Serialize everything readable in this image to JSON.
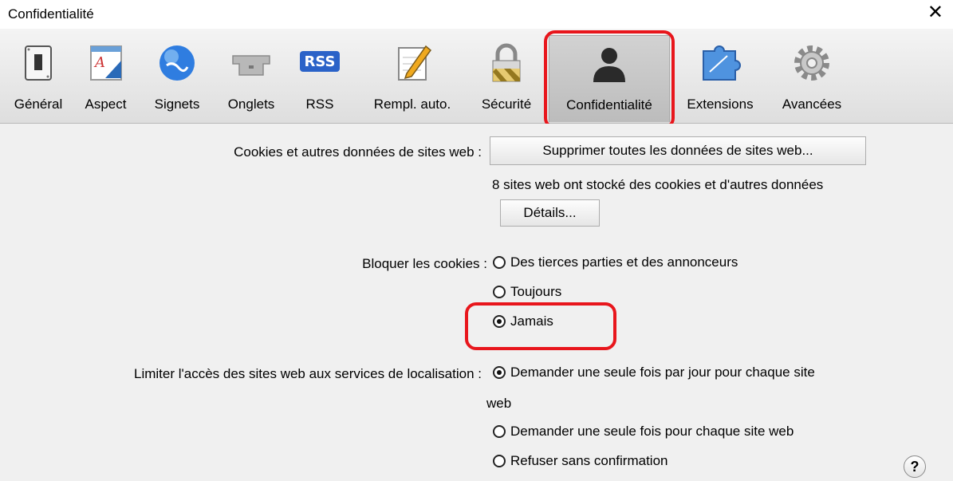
{
  "window": {
    "title": "Confidentialité"
  },
  "toolbar": {
    "items": [
      {
        "label": "Général",
        "icon": "general-switch-icon"
      },
      {
        "label": "Aspect",
        "icon": "appearance-icon"
      },
      {
        "label": "Signets",
        "icon": "globe-icon"
      },
      {
        "label": "Onglets",
        "icon": "tabs-icon"
      },
      {
        "label": "RSS",
        "icon": "rss-icon",
        "icon_text": "RSS"
      },
      {
        "label": "Rempl. auto.",
        "icon": "autofill-pencil-icon"
      },
      {
        "label": "Sécurité",
        "icon": "padlock-icon"
      },
      {
        "label": "Confidentialité",
        "icon": "person-silhouette-icon",
        "selected": true
      },
      {
        "label": "Extensions",
        "icon": "puzzle-icon"
      },
      {
        "label": "Avancées",
        "icon": "gear-icon"
      }
    ]
  },
  "cookies": {
    "label": "Cookies et autres données de sites web :",
    "remove_all_button": "Supprimer toutes les données de sites web...",
    "info": "8 sites web ont stocké des cookies et d'autres données",
    "details_button": "Détails..."
  },
  "block_cookies": {
    "label": "Bloquer les cookies :",
    "options": [
      {
        "label": "Des tierces parties et des annonceurs",
        "checked": false
      },
      {
        "label": "Toujours",
        "checked": false
      },
      {
        "label": "Jamais",
        "checked": true
      }
    ]
  },
  "location": {
    "label": "Limiter l'accès des sites web aux services de localisation :",
    "options": [
      {
        "label": "Demander une seule fois par jour pour chaque site",
        "checked": true
      },
      {
        "label": "Demander une seule fois pour chaque site web",
        "checked": false
      },
      {
        "label": "Refuser sans confirmation",
        "checked": false
      }
    ],
    "wrap_text": "web"
  },
  "help": {
    "label": "?"
  },
  "colors": {
    "highlight": "#e8161c",
    "panel": "#f0f0f0"
  }
}
